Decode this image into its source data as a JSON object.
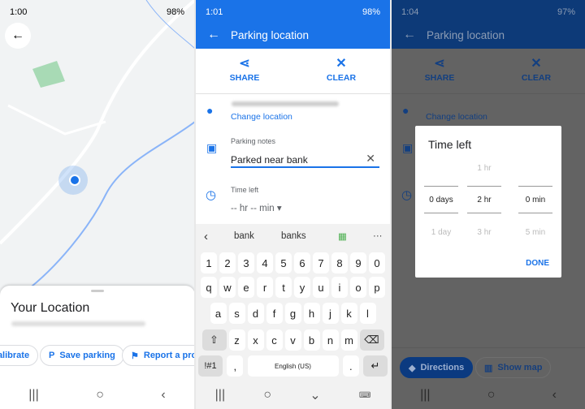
{
  "screen1": {
    "status": {
      "time": "1:00",
      "battery": "98%"
    },
    "sheet": {
      "title": "Your Location"
    },
    "chips": [
      {
        "label": "Calibrate"
      },
      {
        "label": "Save parking",
        "icon": "parking-icon"
      },
      {
        "label": "Report a problem",
        "icon": "report-icon"
      }
    ]
  },
  "screen2": {
    "status": {
      "time": "1:01",
      "battery": "98%"
    },
    "appbar_title": "Parking location",
    "share": "SHARE",
    "clear": "CLEAR",
    "change_location": "Change location",
    "notes_label": "Parking notes",
    "notes_value": "Parked near bank",
    "time_label": "Time left",
    "time_value": "-- hr -- min",
    "keyboard": {
      "suggestions": [
        "bank",
        "banks"
      ],
      "rows": [
        [
          "1",
          "2",
          "3",
          "4",
          "5",
          "6",
          "7",
          "8",
          "9",
          "0"
        ],
        [
          "q",
          "w",
          "e",
          "r",
          "t",
          "y",
          "u",
          "i",
          "o",
          "p"
        ],
        [
          "a",
          "s",
          "d",
          "f",
          "g",
          "h",
          "j",
          "k",
          "l"
        ],
        [
          "z",
          "x",
          "c",
          "v",
          "b",
          "n",
          "m"
        ]
      ],
      "symbols": "!#1",
      "comma": ",",
      "space": "English (US)",
      "period": "."
    }
  },
  "screen3": {
    "status": {
      "time": "1:04",
      "battery": "97%"
    },
    "appbar_title": "Parking location",
    "share": "SHARE",
    "clear": "CLEAR",
    "change_location": "Change location",
    "dialog": {
      "title": "Time left",
      "days": {
        "selected": "0 days",
        "next": "1 day"
      },
      "hours": {
        "prev": "1 hr",
        "selected": "2 hr",
        "next": "3 hr"
      },
      "minutes": {
        "selected": "0 min",
        "next": "5 min"
      },
      "done": "DONE"
    },
    "directions": "Directions",
    "show_map": "Show map"
  },
  "colors": {
    "accent": "#1a73e8",
    "map_bg": "#f1f3f4",
    "park": "#a8dab5"
  }
}
